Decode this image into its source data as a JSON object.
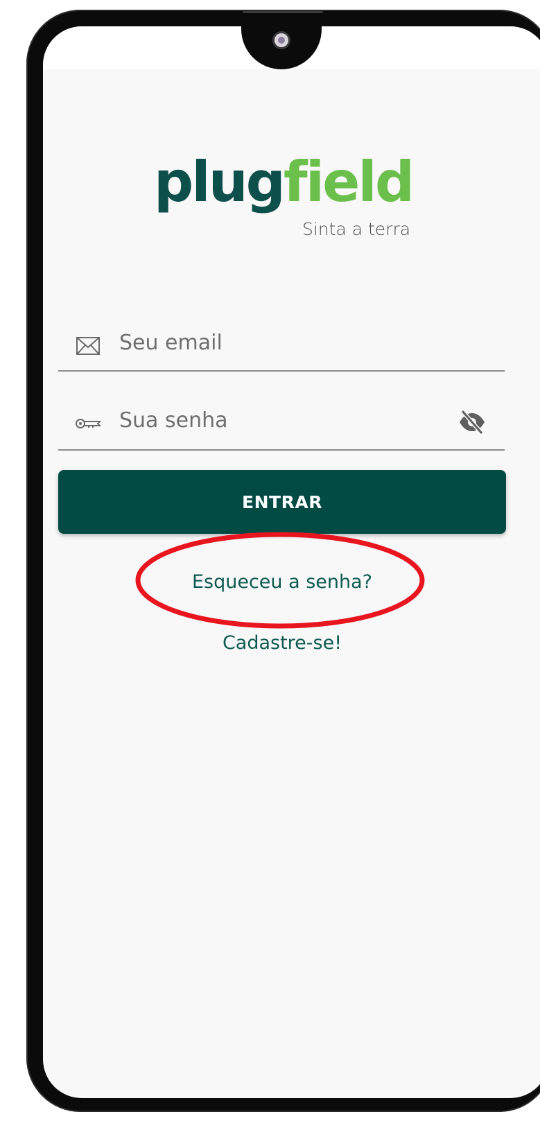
{
  "logo": {
    "wordmark_part1": "plug",
    "wordmark_part2": "field",
    "tagline": "Sinta a terra"
  },
  "email_field": {
    "placeholder": "Seu email",
    "value": "",
    "icon": "envelope-icon"
  },
  "password_field": {
    "placeholder": "Sua senha",
    "value": "",
    "icon": "key-icon",
    "toggle_icon": "eye-off-icon"
  },
  "login_button": {
    "label": "ENTRAR"
  },
  "links": {
    "forgot_password": "Esqueceu a senha?",
    "signup": "Cadastre-se!"
  },
  "colors": {
    "primary": "#024b45",
    "brand_green": "#6bc04b",
    "link": "#0e5a52",
    "highlight": "#e8141e"
  }
}
